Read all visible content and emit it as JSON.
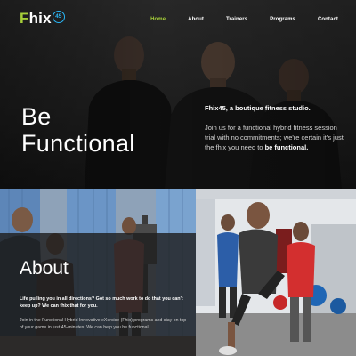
{
  "brand": {
    "logo_initial": "F",
    "logo_rest": "hix",
    "logo_badge": "45",
    "accent_color": "#a6ce39",
    "badge_color": "#29b6f6"
  },
  "nav": {
    "items": [
      {
        "label": "Home",
        "active": true
      },
      {
        "label": "About",
        "active": false
      },
      {
        "label": "Trainers",
        "active": false
      },
      {
        "label": "Programs",
        "active": false
      },
      {
        "label": "Contact",
        "active": false
      }
    ]
  },
  "hero": {
    "title_line1": "Be",
    "title_line2": "Functional",
    "heading": "Fhix45, a boutique fitness studio.",
    "body_text": "Join us for a functional hybrid fitness session trial with no commitments; we're certain it's just the fhix you need to ",
    "body_emphasis": "be functional."
  },
  "about": {
    "title": "About",
    "lead": "Life pulling you in all directions? Got so much work to do that you can't keep up? We can fhix that for you.",
    "body": "Join in the Functional Hybrid Innovative eXercise (Fhix) programs and stay on top of your game in just 45-minutes. We can help you be functional."
  }
}
